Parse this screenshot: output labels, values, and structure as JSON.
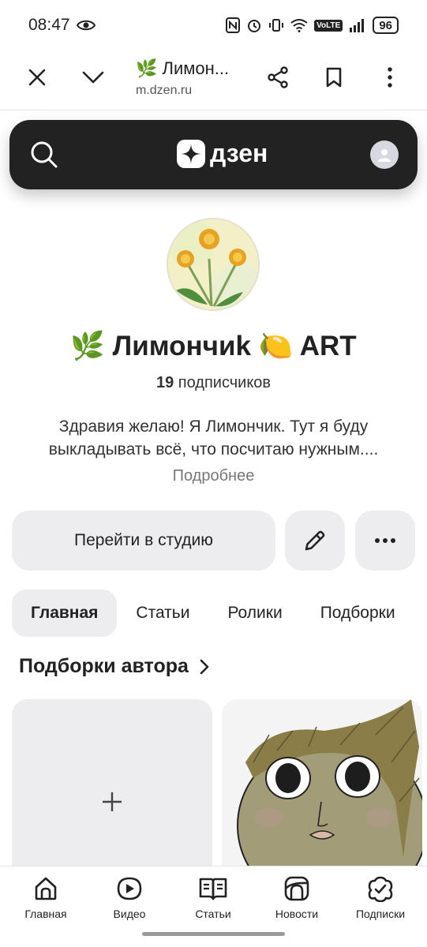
{
  "status_bar": {
    "time": "08:47",
    "volte": "VoLTE",
    "battery": "96"
  },
  "browser": {
    "tab_title": "🌿 Лимон...",
    "url": "m.dzen.ru"
  },
  "dzen": {
    "logo_text": "дзен"
  },
  "channel": {
    "name": "🌿 Лимончиk 🍋 ART",
    "subscribers_count": "19",
    "subscribers_label": "подписчиков",
    "description": "Здравия желаю! Я Лимончик. Тут я буду выкладывать всё, что посчитаю нужным....",
    "more_label": "Подробнее"
  },
  "actions": {
    "studio_label": "Перейти в студию"
  },
  "tabs": [
    {
      "label": "Главная",
      "active": true
    },
    {
      "label": "Статьи",
      "active": false
    },
    {
      "label": "Ролики",
      "active": false
    },
    {
      "label": "Подборки",
      "active": false
    }
  ],
  "section": {
    "title": "Подборки автора"
  },
  "bottom_nav": [
    {
      "label": "Главная",
      "icon": "home-icon"
    },
    {
      "label": "Видео",
      "icon": "video-icon"
    },
    {
      "label": "Статьи",
      "icon": "articles-icon"
    },
    {
      "label": "Новости",
      "icon": "news-icon"
    },
    {
      "label": "Подписки",
      "icon": "subscriptions-icon"
    }
  ]
}
